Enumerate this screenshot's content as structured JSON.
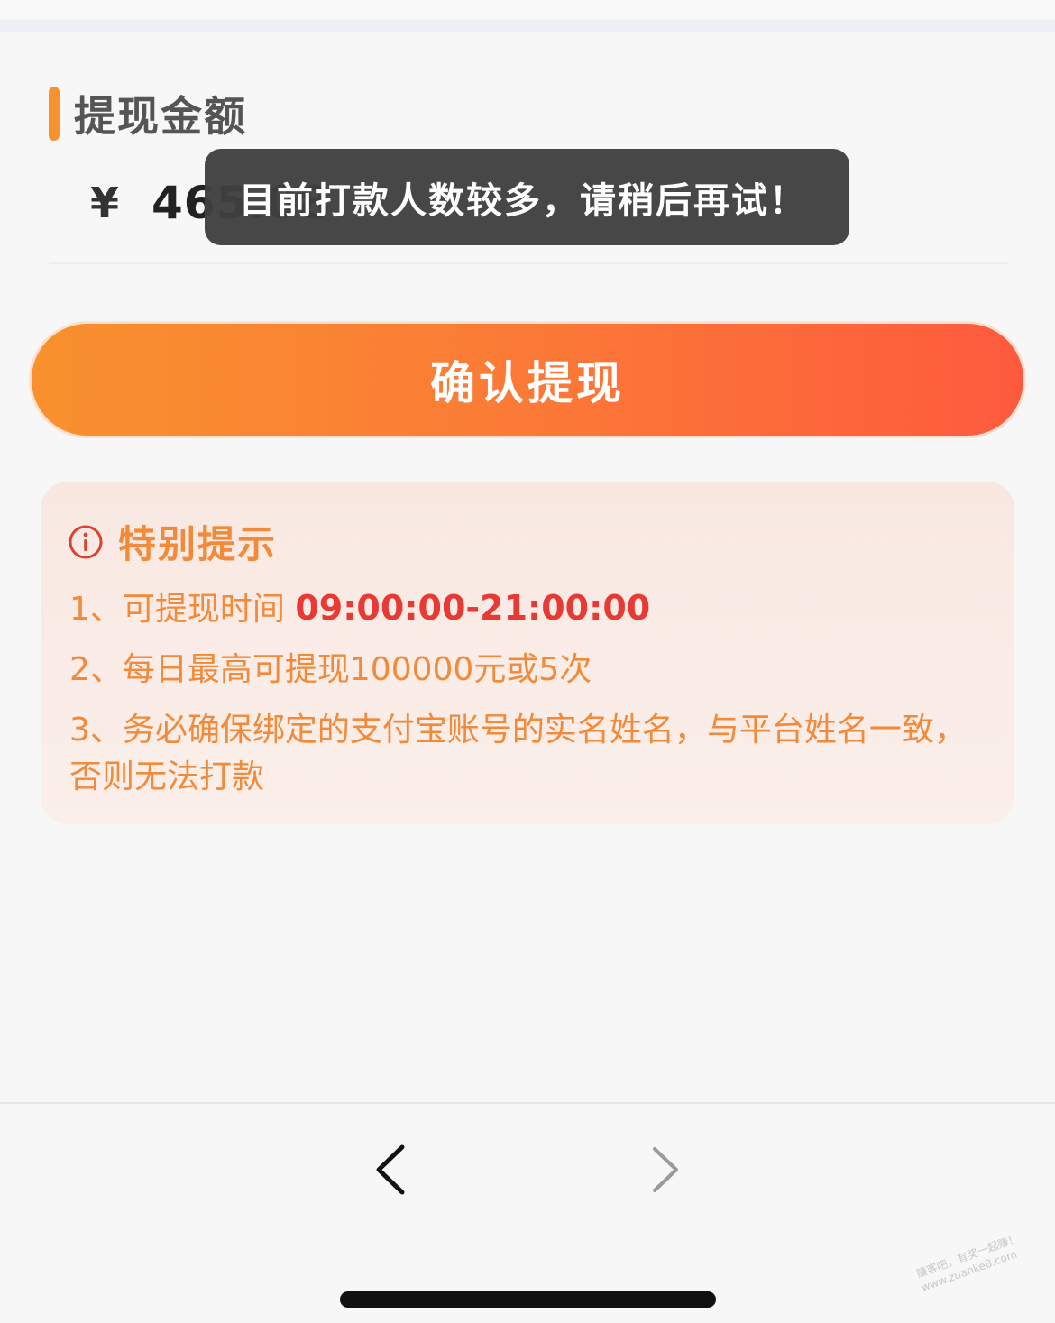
{
  "withdraw": {
    "section_title": "提现金额",
    "currency_symbol": "¥",
    "amount": "465.08"
  },
  "toast": {
    "message": "目前打款人数较多，请稍后再试！"
  },
  "confirm_button": {
    "label": "确认提现"
  },
  "notice": {
    "title": "特别提示",
    "item1_prefix": "1、可提现时间 ",
    "item1_time": "09:00:00-21:00:00",
    "item2": "2、每日最高可提现100000元或5次",
    "item3": "3、务必确保绑定的支付宝账号的实名姓名，与平台姓名一致，否则无法打款"
  },
  "watermark": {
    "line1": "赚客吧，有奖一起赚！",
    "line2": "www.zuanke8.com"
  },
  "colors": {
    "accent_orange": "#f7932f",
    "button_start": "#f8912e",
    "button_end": "#fe5a3e",
    "notice_text": "#f28a3a",
    "highlight_red": "#e83a35"
  }
}
